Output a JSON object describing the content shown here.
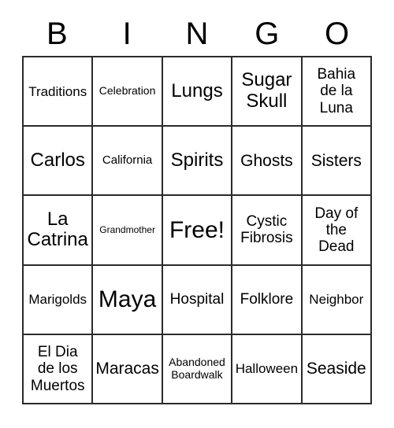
{
  "card": {
    "header_letters": [
      "B",
      "I",
      "N",
      "G",
      "O"
    ],
    "grid": {
      "rows": 5,
      "columns": 5,
      "cells": [
        {
          "text": "Traditions",
          "size": "m"
        },
        {
          "text": "Celebration",
          "size": "s"
        },
        {
          "text": "Lungs",
          "size": "xl"
        },
        {
          "text": "Sugar\nSkull",
          "size": "xl"
        },
        {
          "text": "Bahia\nde la\nLuna",
          "size": "ml"
        },
        {
          "text": "Carlos",
          "size": "xl"
        },
        {
          "text": "California",
          "size": "sm"
        },
        {
          "text": "Spirits",
          "size": "xl"
        },
        {
          "text": "Ghosts",
          "size": "l"
        },
        {
          "text": "Sisters",
          "size": "l"
        },
        {
          "text": "La\nCatrina",
          "size": "xl"
        },
        {
          "text": "Grandmother",
          "size": "xs"
        },
        {
          "text": "Free!",
          "size": "xxl"
        },
        {
          "text": "Cystic\nFibrosis",
          "size": "ml"
        },
        {
          "text": "Day of\nthe\nDead",
          "size": "ml"
        },
        {
          "text": "Marigolds",
          "size": "m"
        },
        {
          "text": "Maya",
          "size": "xxl"
        },
        {
          "text": "Hospital",
          "size": "ml"
        },
        {
          "text": "Folklore",
          "size": "ml"
        },
        {
          "text": "Neighbor",
          "size": "m"
        },
        {
          "text": "El Dia\nde los\nMuertos",
          "size": "ml"
        },
        {
          "text": "Maracas",
          "size": "l"
        },
        {
          "text": "Abandoned\nBoardwalk",
          "size": "s"
        },
        {
          "text": "Halloween",
          "size": "m"
        },
        {
          "text": "Seaside",
          "size": "l"
        }
      ]
    },
    "colors": {
      "background": "#ffffff",
      "border": "#2b2b2b",
      "text": "#000000"
    }
  }
}
